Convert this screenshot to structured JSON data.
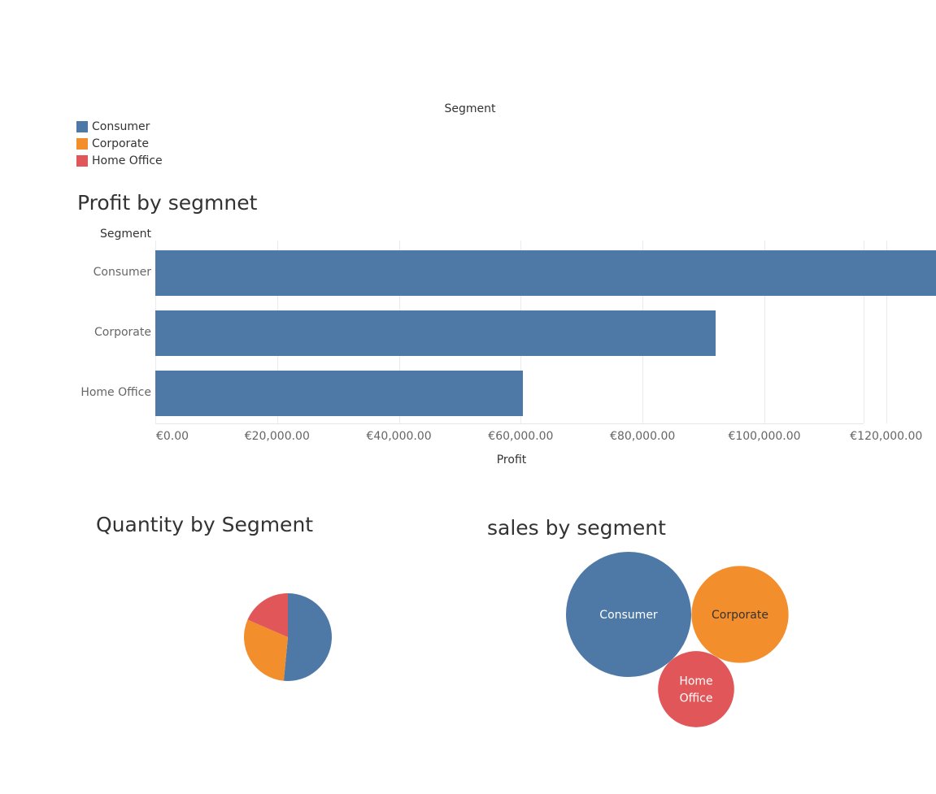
{
  "legend": {
    "title": "Segment",
    "items": [
      {
        "label": "Consumer",
        "color": "#4e79a7"
      },
      {
        "label": "Corporate",
        "color": "#f28e2b"
      },
      {
        "label": "Home Office",
        "color": "#e15759"
      }
    ]
  },
  "chart_data": [
    {
      "type": "bar",
      "orientation": "horizontal",
      "title": "Profit by segmnet",
      "row_header": "Segment",
      "xlabel": "Profit",
      "categories": [
        "Consumer",
        "Corporate",
        "Home Office"
      ],
      "values": [
        134000,
        92000,
        60300
      ],
      "xlim": [
        0,
        140000
      ],
      "x_ticks": [
        "€0.00",
        "€20,000.00",
        "€40,000.00",
        "€60,000.00",
        "€80,000.00",
        "€100,000.00",
        "€120,000.00"
      ],
      "grid": true,
      "color": "#4e79a7"
    },
    {
      "type": "pie",
      "title": "Quantity by Segment",
      "categories": [
        "Consumer",
        "Corporate",
        "Home Office"
      ],
      "values": [
        51.5,
        30.0,
        18.5
      ],
      "colors": [
        "#4e79a7",
        "#f28e2b",
        "#e15759"
      ]
    },
    {
      "type": "bubble",
      "title": "sales by segment",
      "categories": [
        "Consumer",
        "Corporate",
        "Home Office"
      ],
      "labels": [
        "Consumer",
        "Corporate",
        "Home Office"
      ],
      "values": [
        1.0,
        0.6,
        0.37
      ],
      "colors": [
        "#4e79a7",
        "#f28e2b",
        "#e15759"
      ]
    }
  ]
}
